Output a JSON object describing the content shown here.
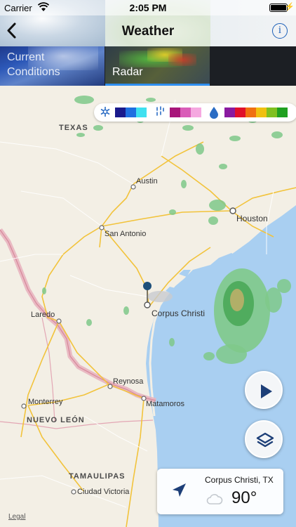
{
  "status_bar": {
    "carrier": "Carrier",
    "time": "2:05 PM"
  },
  "nav": {
    "title": "Weather",
    "back_icon": "chevron-left-icon",
    "info_icon": "info-icon",
    "info_glyph": "i"
  },
  "tabs": [
    {
      "label": "Current\nConditions",
      "selected": false
    },
    {
      "label": "Radar",
      "selected": true
    }
  ],
  "legend": {
    "snow_colors": [
      "#1a1a8c",
      "#1f6fe0",
      "#3fe0f0"
    ],
    "mix_colors": [
      "#a8157a",
      "#d95cb8",
      "#f5a8e0"
    ],
    "rain_colors": [
      "#8a1aa0",
      "#e0102a",
      "#f07010",
      "#f0c010",
      "#80c020",
      "#20a020"
    ]
  },
  "map": {
    "state_labels": [
      "TEXAS",
      "NUEVO LEÓN",
      "TAMAULIPAS"
    ],
    "cities": [
      "Austin",
      "Houston",
      "San Antonio",
      "Corpus Christi",
      "Laredo",
      "Reynosa",
      "Monterrey",
      "Matamoros",
      "Ciudad Victoria"
    ],
    "legal": "Legal"
  },
  "controls": {
    "play_icon": "play-icon",
    "layers_icon": "layers-icon"
  },
  "location_card": {
    "name": "Corpus Christi, TX",
    "temperature": "90°",
    "condition_icon": "cloud-icon",
    "locate_icon": "location-arrow-icon"
  },
  "colors": {
    "accent": "#1b5fb8",
    "tab_underline": "#2e8ef0",
    "water": "#a9cff1"
  }
}
